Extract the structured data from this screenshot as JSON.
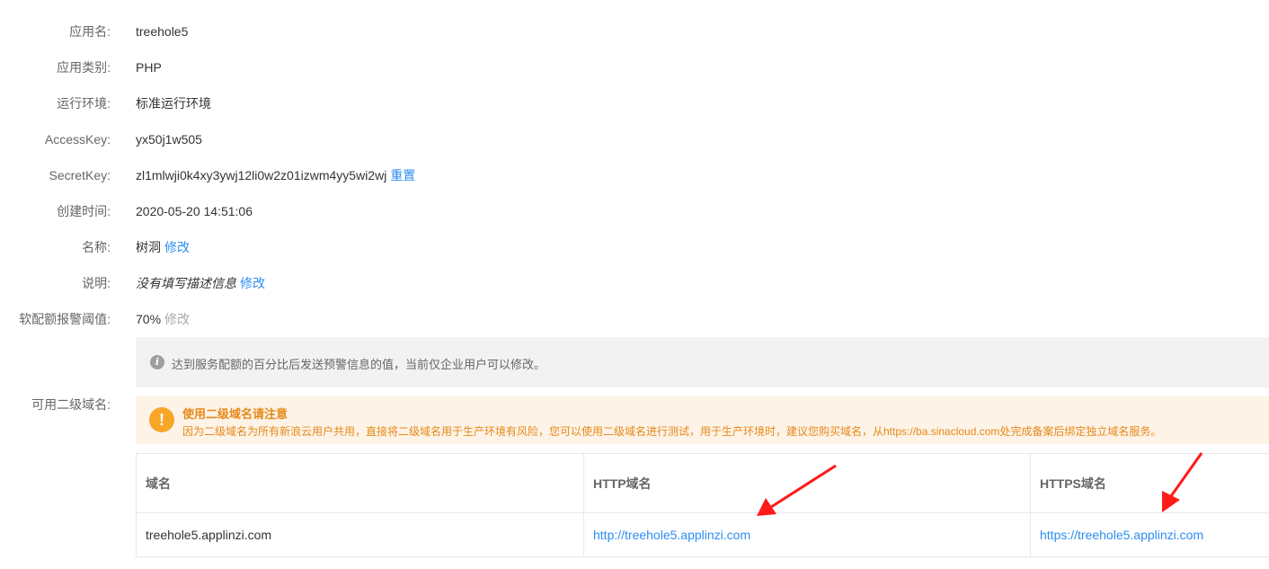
{
  "info": {
    "app_name_label": "应用名:",
    "app_name_value": "treehole5",
    "app_type_label": "应用类别:",
    "app_type_value": "PHP",
    "runtime_label": "运行环境:",
    "runtime_value": "标准运行环境",
    "access_key_label": "AccessKey:",
    "access_key_value": "yx50j1w505",
    "secret_key_label": "SecretKey:",
    "secret_key_value": "zl1mlwji0k4xy3ywj12li0w2z01izwm4yy5wi2wj",
    "secret_key_action": "重置",
    "created_label": "创建时间:",
    "created_value": "2020-05-20 14:51:06",
    "name_label": "名称:",
    "name_value": "树洞",
    "name_action": "修改",
    "desc_label": "说明:",
    "desc_value": "没有填写描述信息",
    "desc_action": "修改",
    "quota_label": "软配额报警阈值:",
    "quota_value": "70%",
    "quota_action": "修改"
  },
  "quota_note": {
    "icon": "info-icon",
    "text": "达到服务配额的百分比后发送预警信息的值，当前仅企业用户可以修改。"
  },
  "subdomain": {
    "label": "可用二级域名:",
    "warning_icon": "exclamation-icon",
    "warning_title": "使用二级域名请注意",
    "warning_text": "因为二级域名为所有新浪云用户共用，直接将二级域名用于生产环境有风险，您可以使用二级域名进行测试，用于生产环境时，建议您购买域名，从https://ba.sinacloud.com处完成备案后绑定独立域名服务。",
    "table": {
      "headers": [
        "域名",
        "HTTP域名",
        "HTTPS域名"
      ],
      "rows": [
        {
          "domain": "treehole5.applinzi.com",
          "http": "http://treehole5.applinzi.com",
          "https": "https://treehole5.applinzi.com"
        }
      ]
    }
  },
  "colors": {
    "link": "#2d8cf0",
    "warning": "#e6891a",
    "arrow": "#ff1a1a"
  }
}
